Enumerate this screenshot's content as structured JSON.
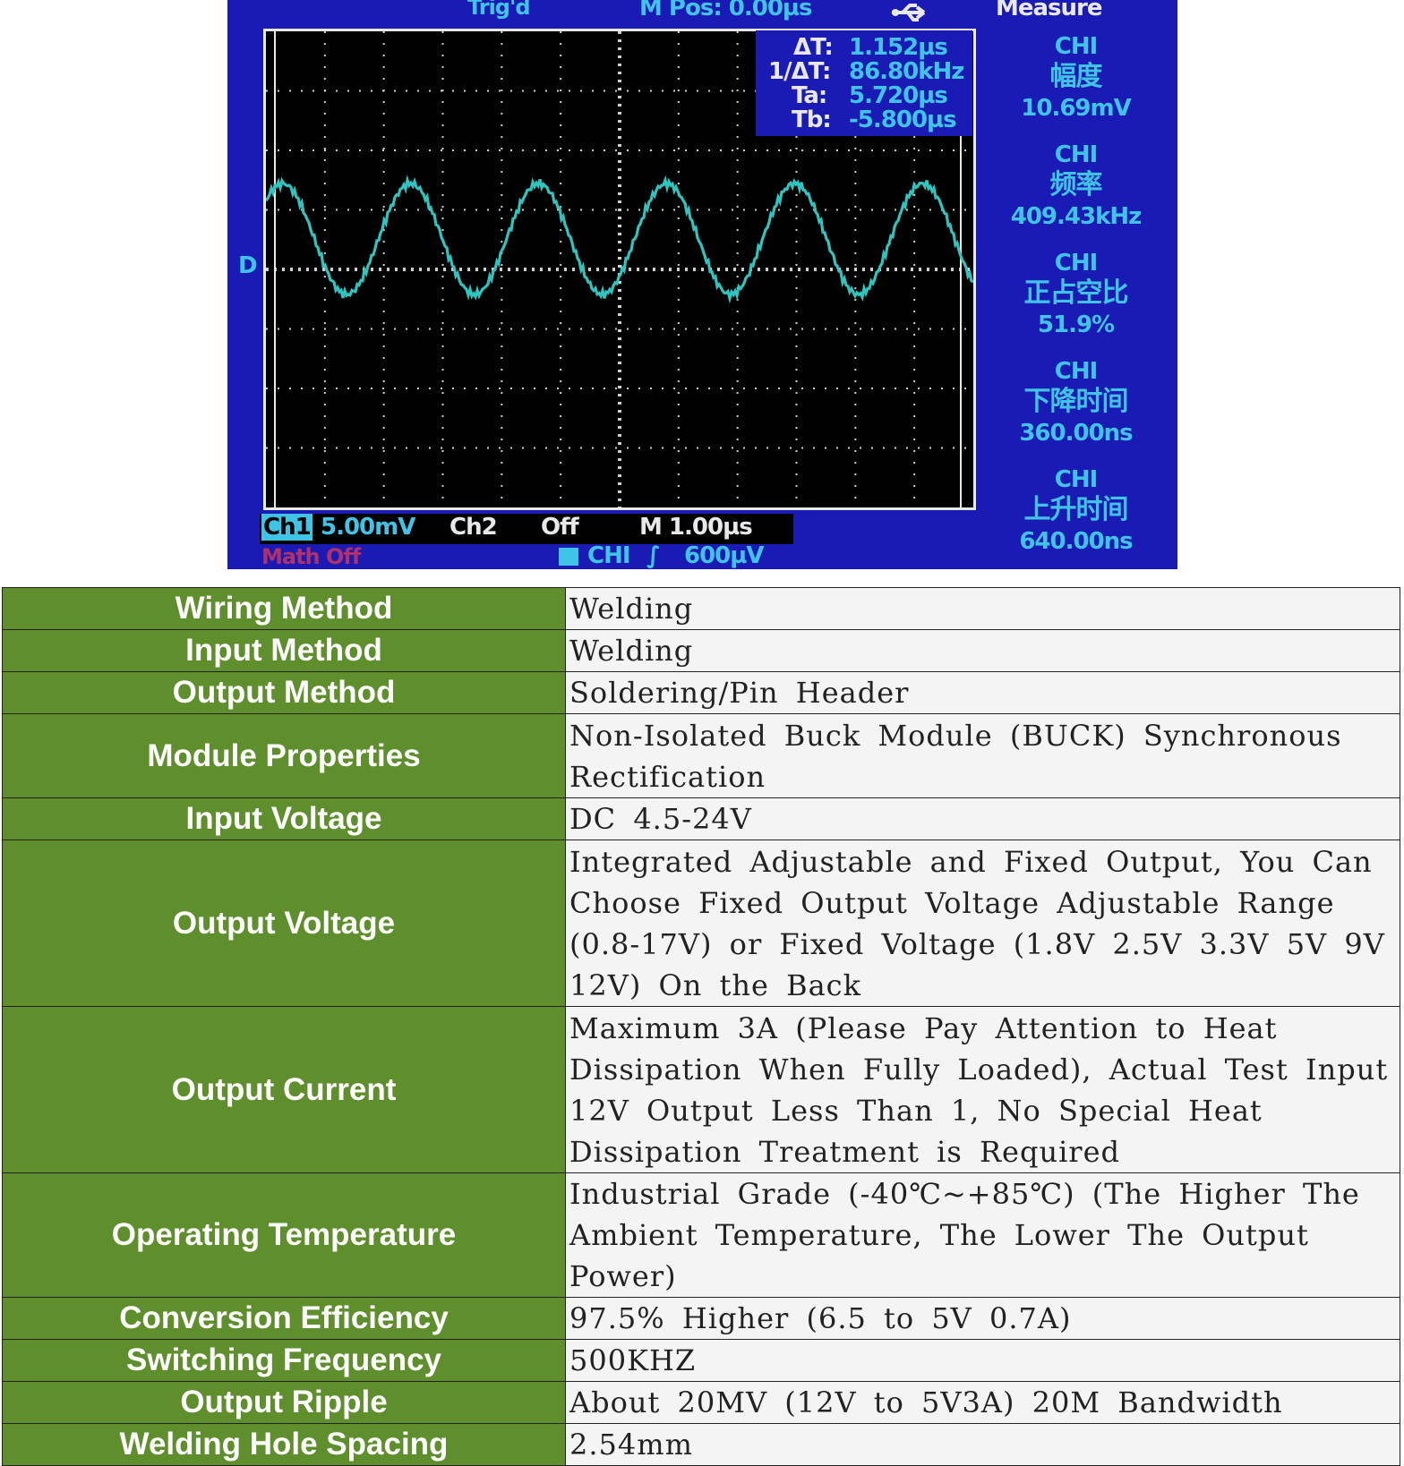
{
  "scope": {
    "top_bar": {
      "trig": "Trig'd",
      "hpos": "M Pos: 0.00µs",
      "measure": "Measure"
    },
    "cursor": {
      "dt_label": "ΔT:",
      "dt_value": "1.152µs",
      "inv_label": "1/ΔT:",
      "inv_value": "86.80kHz",
      "ta_label": "Ta:",
      "ta_value": "5.720µs",
      "tb_label": "Tb:",
      "tb_value": "-5.800µs"
    },
    "measurements": [
      {
        "channel": "CHI",
        "name": "幅度",
        "value": "10.69mV"
      },
      {
        "channel": "CHI",
        "name": "频率",
        "value": "409.43kHz"
      },
      {
        "channel": "CHI",
        "name": "正占空比",
        "value": "51.9%"
      },
      {
        "channel": "CHI",
        "name": "下降时间",
        "value": "360.00ns"
      },
      {
        "channel": "CHI",
        "name": "上升时间",
        "value": "640.00ns"
      }
    ],
    "bottom": {
      "ch1": "Ch1",
      "ch1_scale": "5.00mV",
      "ch2": "Ch2",
      "ch2_state": "Off",
      "timebase": "M 1.00µs",
      "math": "Math Off",
      "trig_src": "CHI",
      "trig_slope": "∫",
      "trig_level": "600µV"
    },
    "marker_d": "D"
  },
  "specs": [
    {
      "label": "Wiring Method",
      "value": "Welding"
    },
    {
      "label": "Input Method",
      "value": "Welding"
    },
    {
      "label": "Output Method",
      "value": "Soldering/Pin Header"
    },
    {
      "label": "Module Properties",
      "value": "Non-Isolated Buck Module (BUCK) Synchronous Rectification"
    },
    {
      "label": "Input Voltage",
      "value": "DC 4.5-24V"
    },
    {
      "label": "Output Voltage",
      "value": "Integrated Adjustable and Fixed Output, You Can Choose Fixed Output Voltage Adjustable Range (0.8-17V) or Fixed Voltage (1.8V 2.5V 3.3V 5V 9V 12V) On the Back"
    },
    {
      "label": "Output Current",
      "value": "Maximum 3A (Please Pay Attention to Heat Dissipation When Fully Loaded), Actual Test Input 12V Output Less Than 1, No Special Heat Dissipation Treatment is Required"
    },
    {
      "label": "Operating Temperature",
      "value": "Industrial Grade (-40℃~+85℃) (The Higher The Ambient Temperature, The Lower The Output Power)"
    },
    {
      "label": "Conversion Efficiency",
      "value": "97.5% Higher (6.5 to 5V 0.7A)"
    },
    {
      "label": "Switching Frequency",
      "value": "500KHZ"
    },
    {
      "label": "Output Ripple",
      "value": "About 20MV (12V to 5V3A) 20M Bandwidth"
    },
    {
      "label": "Welding Hole Spacing",
      "value": "2.54mm"
    }
  ],
  "colors": {
    "screen_bg": "#1a1ab4",
    "trace": "#2ec4c0",
    "label_bg": "#5e8f2c"
  }
}
